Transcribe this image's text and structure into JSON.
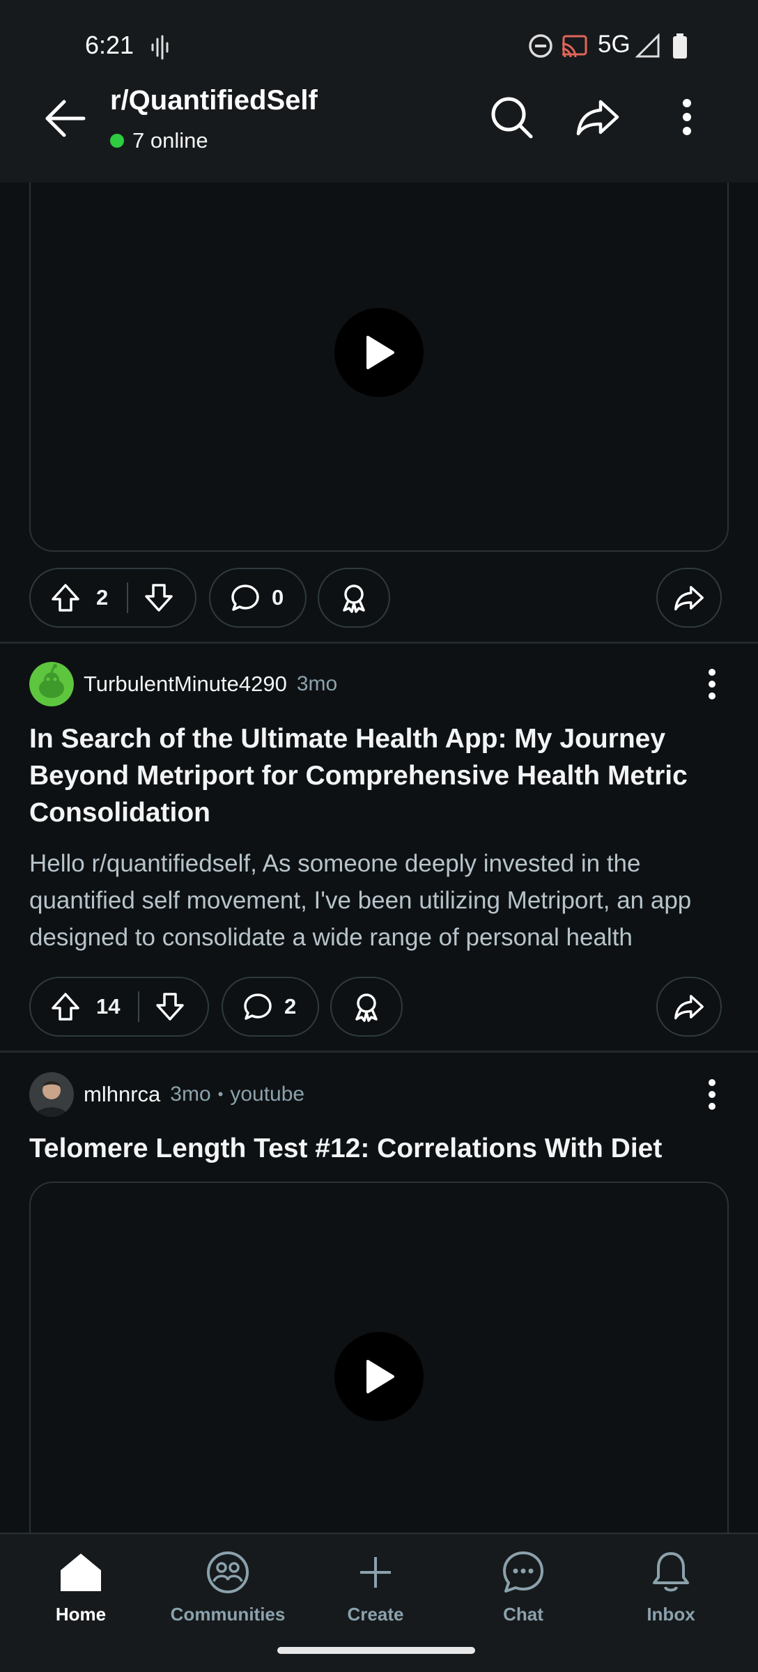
{
  "status_bar": {
    "time": "6:21",
    "network": "5G"
  },
  "header": {
    "subreddit": "r/QuantifiedSelf",
    "online": "7 online"
  },
  "posts": [
    {
      "upvotes": "2",
      "comments": "0"
    },
    {
      "author": "TurbulentMinute4290",
      "age": "3mo",
      "title": "In Search of the Ultimate Health App: My Journey Beyond Metriport for Comprehensive Health Metric Consolidation",
      "body": "Hello r/quantifiedself, As someone deeply invested in the quantified self movement, I've been utilizing Metriport, an app designed to consolidate a wide range of personal health metrics…",
      "upvotes": "14",
      "comments": "2"
    },
    {
      "author": "mlhnrca",
      "age": "3mo",
      "domain": "youtube",
      "title": "Telomere Length Test #12: Correlations With Diet"
    }
  ],
  "nav": [
    {
      "label": "Home",
      "icon": "home-icon",
      "active": true
    },
    {
      "label": "Communities",
      "icon": "communities-icon"
    },
    {
      "label": "Create",
      "icon": "plus-icon"
    },
    {
      "label": "Chat",
      "icon": "chat-icon"
    },
    {
      "label": "Inbox",
      "icon": "bell-icon"
    }
  ],
  "colors": {
    "background": "#0e1113",
    "bar": "#171a1c",
    "online": "#2ecc40",
    "muted": "#8ba2ad"
  }
}
